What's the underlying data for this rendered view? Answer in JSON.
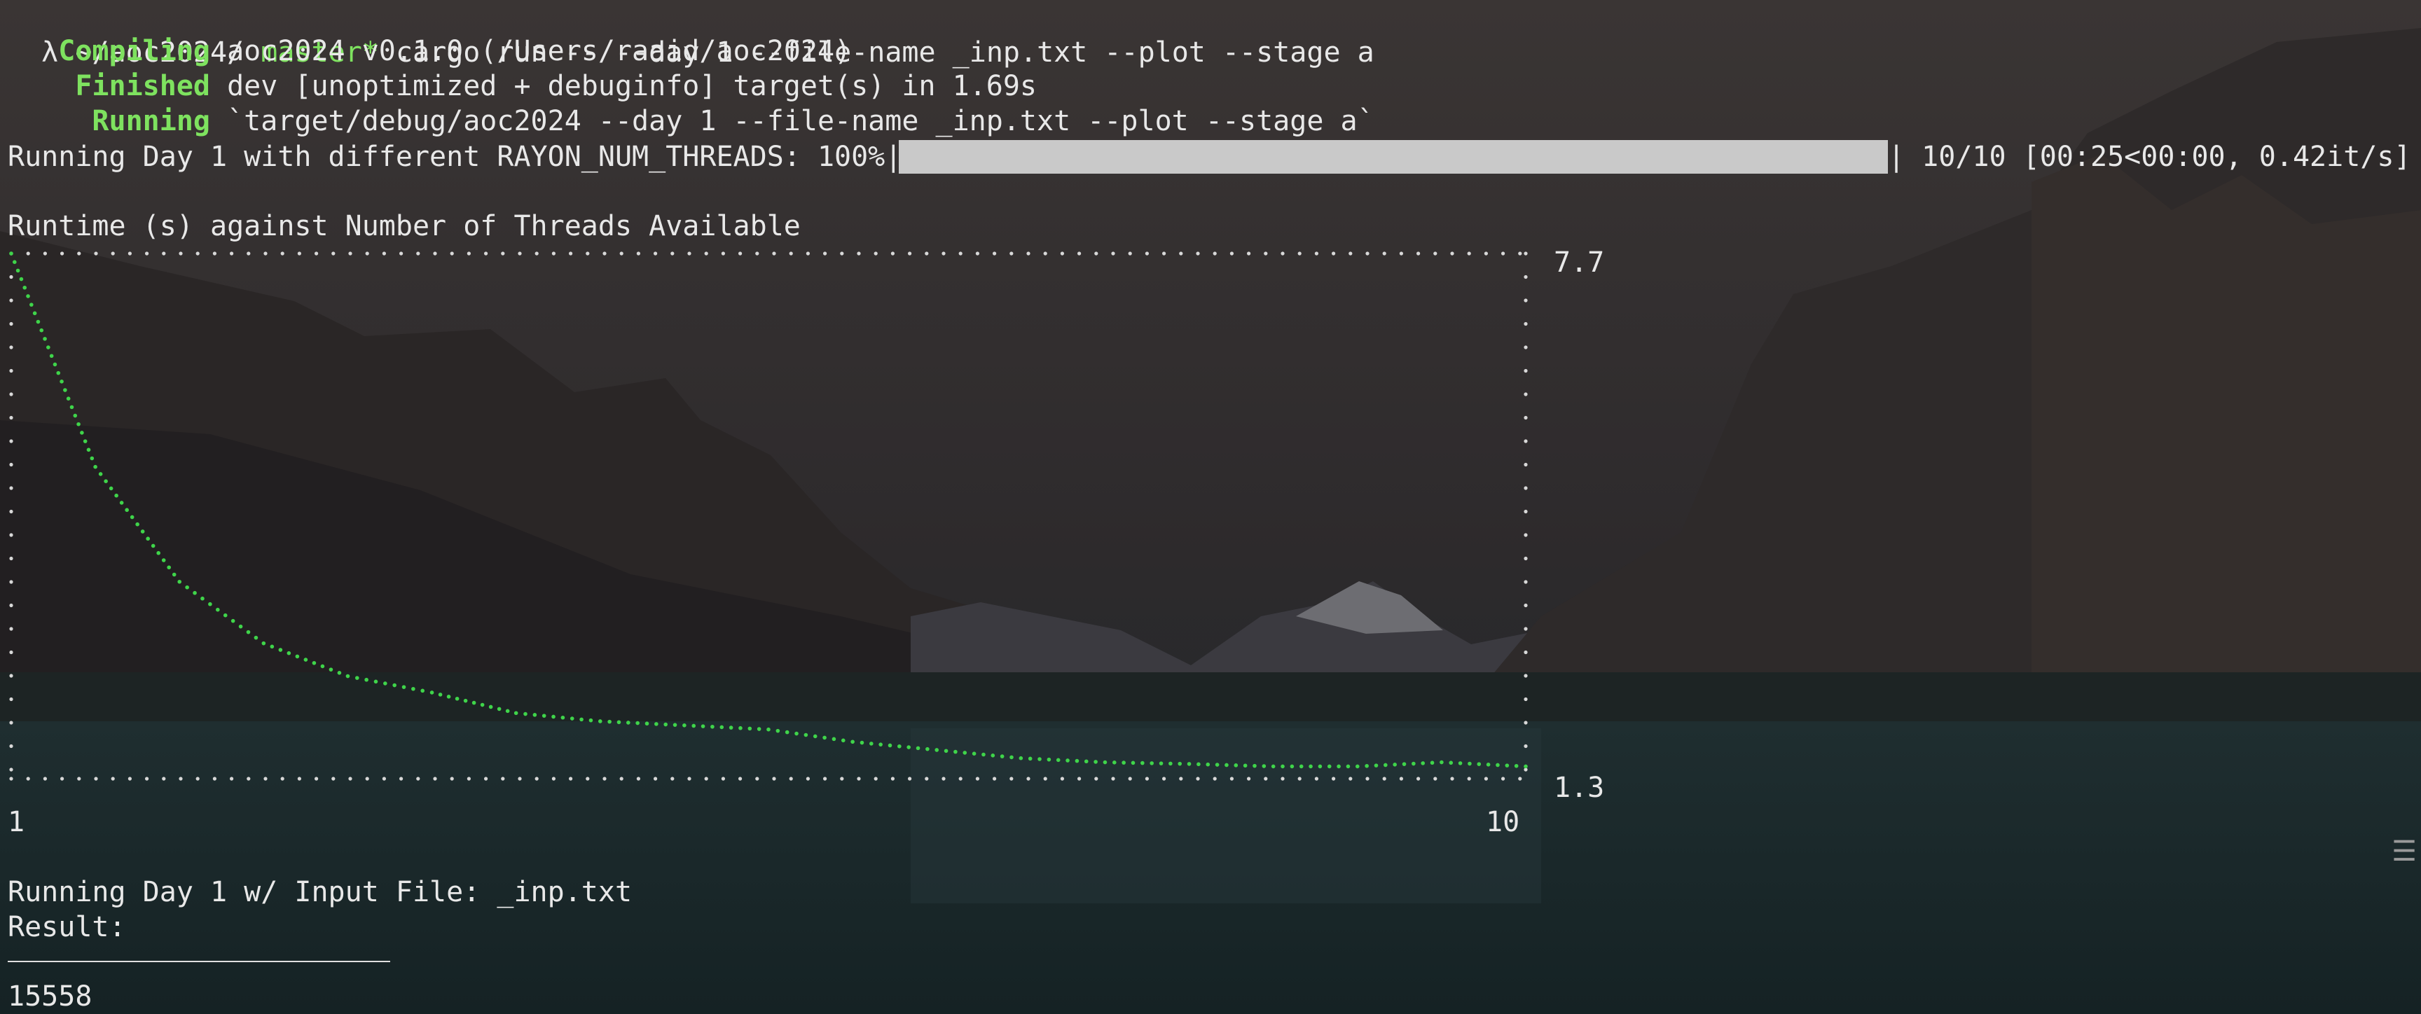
{
  "prompt": {
    "symbol": "λ",
    "cwd": "~/aoc2024/",
    "branch": "master*",
    "command": "cargo run -- --day 1 --file-name _inp.txt --plot --stage a"
  },
  "build": [
    {
      "status": "   Compiling",
      "text": " aoc2024 v0.1.0 (/Users/raaid/aoc2024)"
    },
    {
      "status": "    Finished",
      "text": " dev [unoptimized + debuginfo] target(s) in 1.69s"
    },
    {
      "status": "     Running",
      "text": " `target/debug/aoc2024 --day 1 --file-name _inp.txt --plot --stage a`"
    }
  ],
  "progress": {
    "label": "Running Day 1 with different RAYON_NUM_THREADS: 100%|",
    "fraction": 1.0,
    "stats": "| 10/10 [00:25<00:00, 0.42it/s]"
  },
  "chart_data": {
    "type": "line",
    "title": "Runtime (s) against Number of Threads Available",
    "x_min_label": "1",
    "x_max_label": "10",
    "y_max_label": "7.7",
    "y_min_label": "1.3",
    "xlim": [
      1,
      10
    ],
    "ylim": [
      1.3,
      7.7
    ],
    "series": [
      {
        "color": "#3fd44a",
        "x": [
          1.0,
          1.5,
          2.0,
          2.5,
          3.0,
          3.5,
          4.0,
          4.5,
          5.0,
          5.5,
          6.0,
          6.5,
          7.0,
          7.5,
          8.0,
          8.5,
          9.0,
          9.5,
          10.0
        ],
        "y": [
          7.7,
          5.1,
          3.7,
          2.95,
          2.55,
          2.35,
          2.1,
          2.0,
          1.95,
          1.9,
          1.75,
          1.65,
          1.55,
          1.5,
          1.48,
          1.45,
          1.45,
          1.5,
          1.45
        ]
      }
    ],
    "grid": "dotted border"
  },
  "result": {
    "running_line": "Running Day 1 w/ Input File: _inp.txt",
    "label": "Result:",
    "value": "15558"
  },
  "side_glyph": "☰",
  "colors": {
    "accent_green": "#7ee25f",
    "plot_green": "#3fd44a"
  }
}
